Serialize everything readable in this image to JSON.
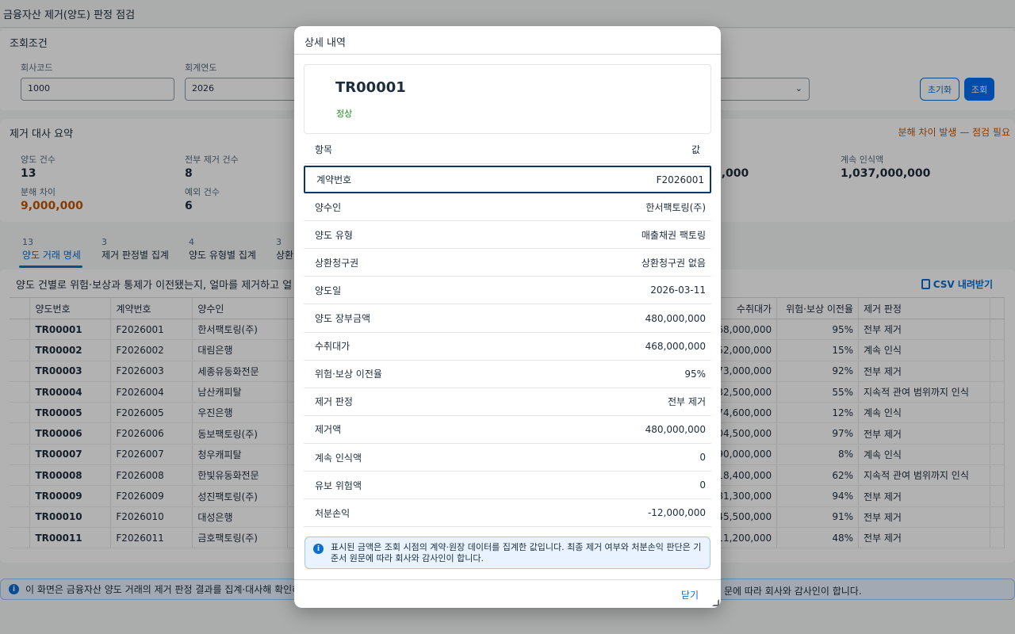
{
  "page": {
    "title": "금융자산 제거(양도) 판정 점검"
  },
  "filter": {
    "heading": "조회조건",
    "company_label": "회사코드",
    "company_value": "1000",
    "year_label": "회계연도",
    "year_value": "2026",
    "reset_label": "초기화",
    "search_label": "조회"
  },
  "summary": {
    "heading": "제거 대사 요약",
    "warning": "분해 차이 발생 — 점검 필요",
    "kpis": [
      {
        "label": "양도 건수",
        "value": "13"
      },
      {
        "label": "전부 제거 건수",
        "value": "8"
      },
      {
        "label": "분해 차이",
        "value": "9,000,000"
      },
      {
        "label": "예외 건수",
        "value": "6"
      },
      {
        "label": "",
        "value": "0,000"
      },
      {
        "label": "계속 인식액",
        "value": "1,037,000,000"
      }
    ]
  },
  "tabs": [
    {
      "count": "13",
      "label": "양도 거래 명세"
    },
    {
      "count": "3",
      "label": "제거 판정별 집계"
    },
    {
      "count": "4",
      "label": "양도 유형별 집계"
    },
    {
      "count": "3",
      "label": "상환"
    }
  ],
  "table": {
    "title": "양도 건별로 위험·보상과 통제가 이전됐는지, 얼마를 제거하고 얼",
    "csv_label": "CSV 내려받기",
    "columns": [
      "양도번호",
      "계약번호",
      "양수인",
      "수취대가",
      "위험·보상 이전율",
      "제거 판정"
    ],
    "rows": [
      [
        "TR00001",
        "F2026001",
        "한서팩토링(주)",
        "68,000,000",
        "95%",
        "전부 제거"
      ],
      [
        "TR00002",
        "F2026002",
        "대림은행",
        "52,000,000",
        "15%",
        "계속 인식"
      ],
      [
        "TR00003",
        "F2026003",
        "세종유동화전문",
        "73,000,000",
        "92%",
        "전부 제거"
      ],
      [
        "TR00004",
        "F2026004",
        "남산캐피탈",
        "32,500,000",
        "55%",
        "지속적 관여 범위까지 인식"
      ],
      [
        "TR00005",
        "F2026005",
        "우진은행",
        "74,600,000",
        "12%",
        "계속 인식"
      ],
      [
        "TR00006",
        "F2026006",
        "동보팩토링(주)",
        "04,500,000",
        "97%",
        "전부 제거"
      ],
      [
        "TR00007",
        "F2026007",
        "청우캐피탈",
        "90,000,000",
        "8%",
        "계속 인식"
      ],
      [
        "TR00008",
        "F2026008",
        "한빛유동화전문",
        "18,400,000",
        "62%",
        "지속적 관여 범위까지 인식"
      ],
      [
        "TR00009",
        "F2026009",
        "성진팩토링(주)",
        "81,300,000",
        "94%",
        "전부 제거"
      ],
      [
        "TR00010",
        "F2026010",
        "대성은행",
        "45,500,000",
        "91%",
        "전부 제거"
      ],
      [
        "TR00011",
        "F2026011",
        "금호팩토링(주)",
        "11,200,000",
        "48%",
        "전부 제거"
      ]
    ]
  },
  "bottom_note": {
    "left": "이 화면은 금융자산 양도 거래의 제거 판정 결과를 집계·대사해 확인하",
    "right": "문에 따라 회사와 감사인이 합니다."
  },
  "dialog": {
    "title": "상세 내역",
    "object_title": "TR00001",
    "object_status": "정상",
    "col_item": "항목",
    "col_value": "값",
    "rows": [
      {
        "k": "계약번호",
        "v": "F2026001"
      },
      {
        "k": "양수인",
        "v": "한서팩토링(주)"
      },
      {
        "k": "양도 유형",
        "v": "매출채권 팩토링"
      },
      {
        "k": "상환청구권",
        "v": "상환청구권 없음"
      },
      {
        "k": "양도일",
        "v": "2026-03-11"
      },
      {
        "k": "양도 장부금액",
        "v": "480,000,000"
      },
      {
        "k": "수취대가",
        "v": "468,000,000"
      },
      {
        "k": "위험·보상 이전율",
        "v": "95%"
      },
      {
        "k": "제거 판정",
        "v": "전부 제거"
      },
      {
        "k": "제거액",
        "v": "480,000,000"
      },
      {
        "k": "계속 인식액",
        "v": "0"
      },
      {
        "k": "유보 위험액",
        "v": "0"
      },
      {
        "k": "처분손익",
        "v": "-12,000,000"
      }
    ],
    "info": "표시된 금액은 조회 시점의 계약·원장 데이터를 집계한 값입니다. 최종 제거 여부와 처분손익 판단은 기준서 원문에 따라 회사와 감사인이 합니다.",
    "close_label": "닫기"
  }
}
